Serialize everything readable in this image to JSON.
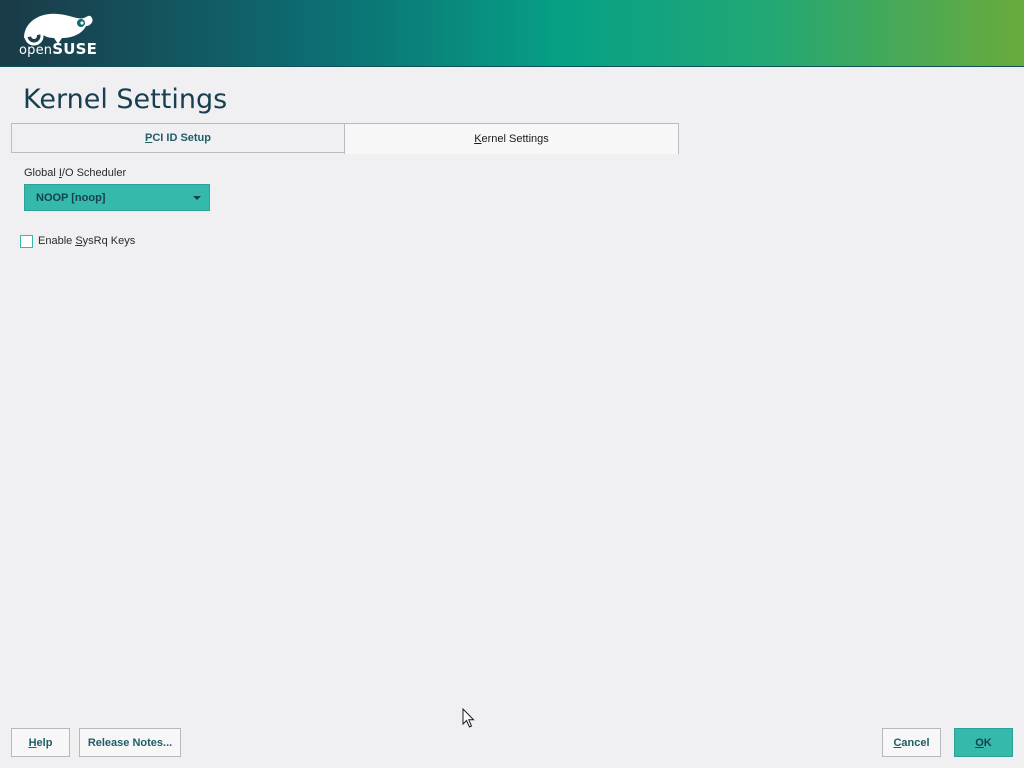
{
  "brand": {
    "logo_prefix": "open",
    "logo_name": "SUSE"
  },
  "page": {
    "title": "Kernel Settings"
  },
  "tabs": [
    {
      "label_first": "P",
      "label_rest": "CI ID Setup",
      "active": false
    },
    {
      "label_first": "K",
      "label_rest": "ernel Settings",
      "active": true
    }
  ],
  "scheduler": {
    "label_pre": "Global ",
    "label_key": "I",
    "label_post": "/O Scheduler",
    "value": "NOOP [noop]"
  },
  "sysrq": {
    "label_pre": "Enable ",
    "label_key": "S",
    "label_post": "ysRq Keys",
    "checked": false
  },
  "buttons": {
    "help_key": "H",
    "help_rest": "elp",
    "release_notes": "Release Notes...",
    "cancel_key": "C",
    "cancel_rest": "ancel",
    "ok_key": "O",
    "ok_rest": "K"
  },
  "colors": {
    "accent": "#35b9ab",
    "title": "#173f4f",
    "banner_start": "#1b3a48",
    "banner_end": "#6aaa3c"
  }
}
